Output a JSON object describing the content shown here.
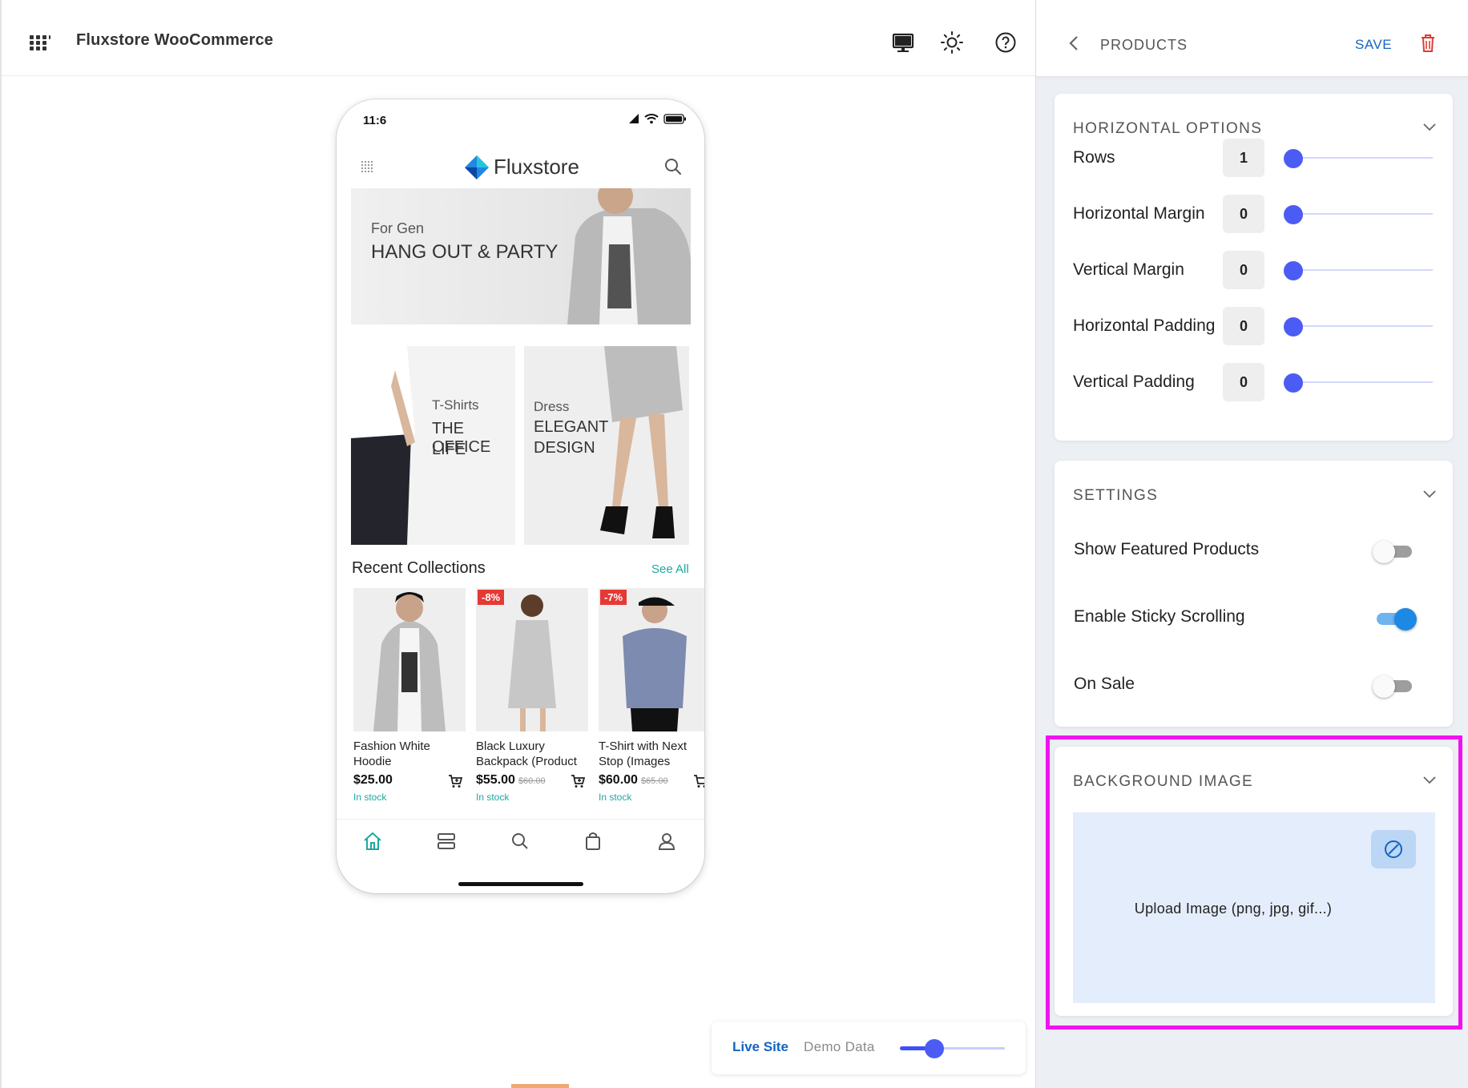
{
  "app": {
    "title": "Fluxstore WooCommerce"
  },
  "phone": {
    "time": "11:6",
    "brand": "Fluxstore",
    "banner_main": {
      "subtitle": "For Gen",
      "headline": "HANG OUT & PARTY"
    },
    "banner_left": {
      "subtitle": "T-Shirts",
      "line1": "THE OFFICE",
      "line2": "LIFE"
    },
    "banner_right": {
      "subtitle": "Dress",
      "line1": "ELEGANT",
      "line2": "DESIGN"
    },
    "recent_title": "Recent Collections",
    "see_all": "See All",
    "products": [
      {
        "name_line1": "Fashion White",
        "name_line2": "Hoodie",
        "price": "$25.00",
        "old_price": "",
        "discount": "",
        "stock": "In stock"
      },
      {
        "name_line1": "Black Luxury",
        "name_line2": "Backpack (Product",
        "price": "$55.00",
        "old_price": "$60.00",
        "discount": "-8%",
        "stock": "In stock"
      },
      {
        "name_line1": "T-Shirt with Next",
        "name_line2": "Stop (Images",
        "price": "$60.00",
        "old_price": "$65.00",
        "discount": "-7%",
        "stock": "In stock"
      }
    ],
    "nav_icons": [
      "home-icon",
      "category-icon",
      "search-icon",
      "bag-icon",
      "user-icon"
    ]
  },
  "mode": {
    "live": "Live Site",
    "demo": "Demo Data",
    "slider_fraction": 0.33
  },
  "panel": {
    "title": "PRODUCTS",
    "save": "SAVE",
    "horizontal": {
      "title": "HORIZONTAL OPTIONS",
      "options": [
        {
          "label": "Rows",
          "value": "1"
        },
        {
          "label": "Horizontal Margin",
          "value": "0"
        },
        {
          "label": "Vertical Margin",
          "value": "0"
        },
        {
          "label": "Horizontal Padding",
          "value": "0"
        },
        {
          "label": "Vertical Padding",
          "value": "0"
        }
      ]
    },
    "settings": {
      "title": "SETTINGS",
      "items": [
        {
          "label": "Show Featured Products",
          "on": false
        },
        {
          "label": "Enable Sticky Scrolling",
          "on": true
        },
        {
          "label": "On Sale",
          "on": false
        }
      ]
    },
    "background": {
      "title": "BACKGROUND IMAGE",
      "upload_text": "Upload Image (png, jpg, gif...)"
    }
  },
  "colors": {
    "accent": "#4b5cf5",
    "link": "#1565c0",
    "teal": "#1fa7a0",
    "highlight": "#f013f0",
    "discount": "#e53935"
  }
}
